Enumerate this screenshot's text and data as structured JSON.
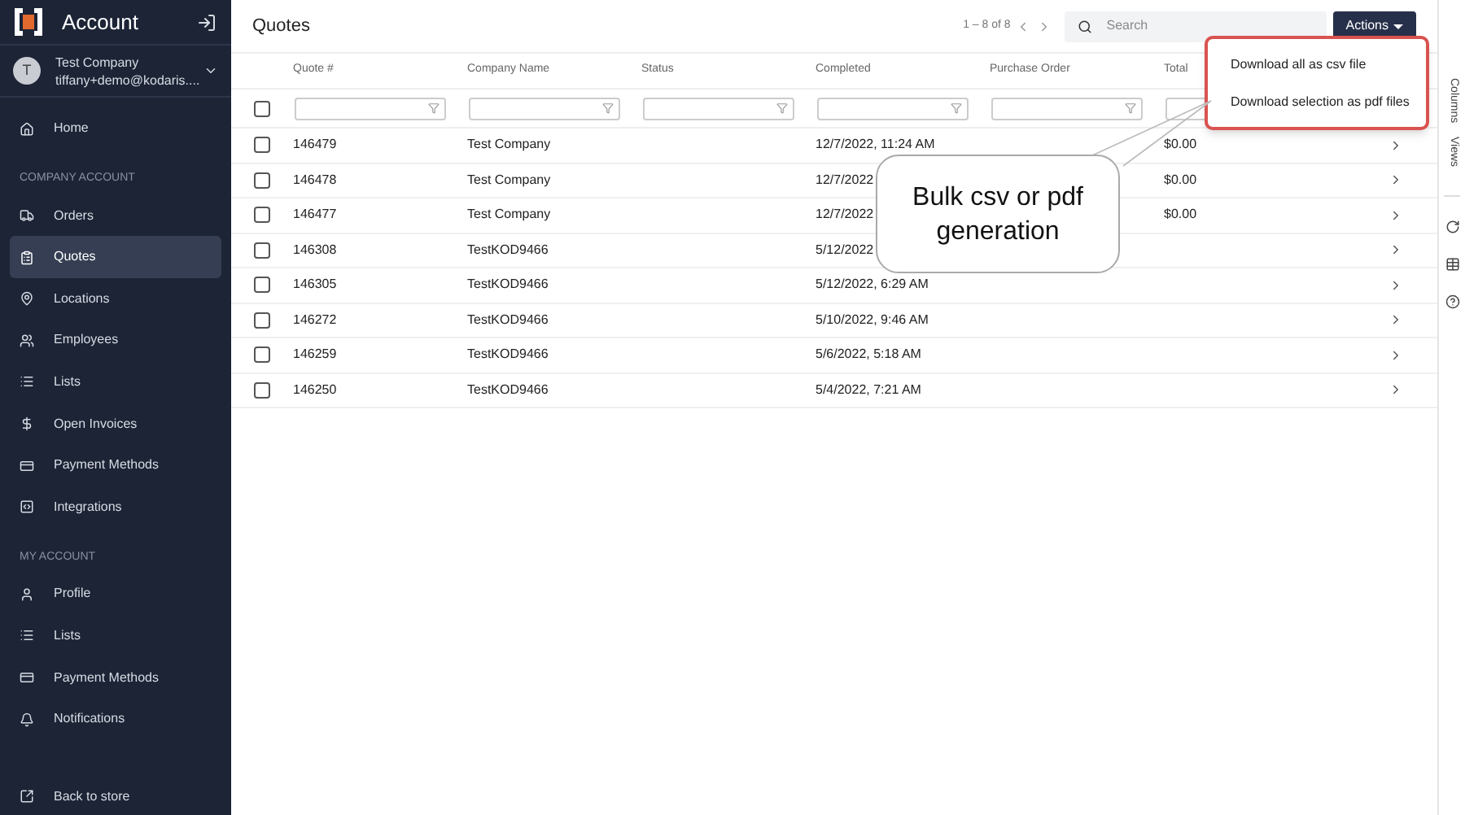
{
  "sidebar": {
    "title": "Account",
    "account": {
      "initial": "T",
      "name": "Test Company",
      "email": "tiffany+demo@kodaris...."
    },
    "sections": [
      {
        "items": [
          {
            "label": "Home",
            "selected": false
          }
        ]
      },
      {
        "heading": "COMPANY ACCOUNT",
        "items": [
          {
            "label": "Orders",
            "selected": false
          },
          {
            "label": "Quotes",
            "selected": true
          },
          {
            "label": "Locations",
            "selected": false
          },
          {
            "label": "Employees",
            "selected": false
          },
          {
            "label": "Lists",
            "selected": false
          },
          {
            "label": "Open Invoices",
            "selected": false
          },
          {
            "label": "Payment Methods",
            "selected": false
          },
          {
            "label": "Integrations",
            "selected": false
          }
        ]
      },
      {
        "heading": "MY ACCOUNT",
        "items": [
          {
            "label": "Profile",
            "selected": false
          },
          {
            "label": "Lists",
            "selected": false
          },
          {
            "label": "Payment Methods",
            "selected": false
          },
          {
            "label": "Notifications",
            "selected": false
          }
        ]
      }
    ],
    "footer": {
      "label": "Back to store"
    }
  },
  "header": {
    "title": "Quotes",
    "pagination": "1 – 8 of 8",
    "search": {
      "placeholder": "Search"
    },
    "actions": "Actions"
  },
  "actions_menu": {
    "items": [
      "Download all as csv file",
      "Download selection as pdf files"
    ]
  },
  "table": {
    "select_all": {
      "checked": false
    },
    "columns": [
      "Quote #",
      "Company Name",
      "Status",
      "Completed",
      "Purchase Order",
      "Total"
    ],
    "rows": [
      {
        "quote": "146479",
        "company": "Test Company",
        "completed": "12/7/2022, 11:24 AM",
        "total": "$0.00",
        "checked": false
      },
      {
        "quote": "146478",
        "company": "Test Company",
        "completed": "12/7/2022",
        "total": "$0.00",
        "checked": false
      },
      {
        "quote": "146477",
        "company": "Test Company",
        "completed": "12/7/2022",
        "total": "$0.00",
        "checked": false
      },
      {
        "quote": "146308",
        "company": "TestKOD9466",
        "completed": "5/12/2022",
        "checked": false
      },
      {
        "quote": "146305",
        "company": "TestKOD9466",
        "completed": "5/12/2022, 6:29 AM",
        "checked": false
      },
      {
        "quote": "146272",
        "company": "TestKOD9466",
        "completed": "5/10/2022, 9:46 AM",
        "checked": false
      },
      {
        "quote": "146259",
        "company": "TestKOD9466",
        "completed": "5/6/2022, 5:18 AM",
        "checked": false
      },
      {
        "quote": "146250",
        "company": "TestKOD9466",
        "completed": "5/4/2022, 7:21 AM",
        "checked": false
      }
    ]
  },
  "callout": {
    "text": "Bulk csv or pdf generation"
  },
  "right_rail": {
    "tabs": [
      "Columns",
      "Views"
    ]
  }
}
